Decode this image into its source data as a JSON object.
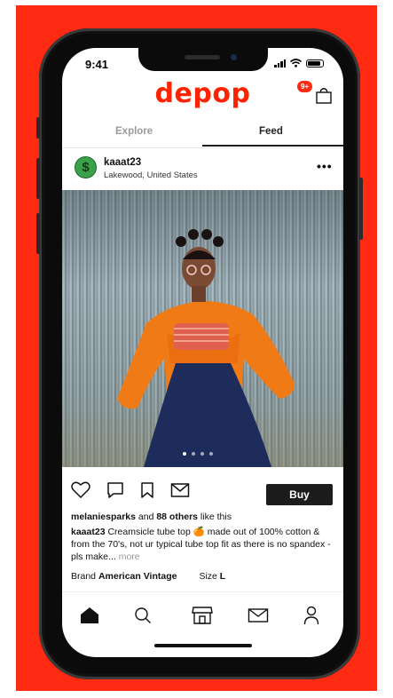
{
  "status_bar": {
    "time": "9:41"
  },
  "header": {
    "logo_text": "depop",
    "bag_badge": "9+"
  },
  "tabs": [
    {
      "label": "Explore",
      "active": false
    },
    {
      "label": "Feed",
      "active": true
    }
  ],
  "post": {
    "username": "kaaat23",
    "location": "Lakewood, United States",
    "avatar_icon": "dollar-sign-icon",
    "image_dots": {
      "count": 4,
      "active_index": 0
    },
    "actions": [
      "heart-icon",
      "comment-icon",
      "bookmark-icon",
      "message-icon"
    ],
    "buy_label": "Buy",
    "likes": {
      "user": "melaniesparks",
      "middle": " and ",
      "others": "88 others",
      "suffix": " like this"
    },
    "description": {
      "user": "kaaat23",
      "text": " Creamsicle tube top 🍊 made out of 100% cotton & from the 70's, not ur typical tube top fit as there is no spandex - pls make...",
      "more": " more"
    },
    "brand_label": "Brand ",
    "brand_value": "American Vintage",
    "size_label": "Size ",
    "size_value": "L"
  },
  "bottom_nav": [
    "home-icon",
    "search-icon",
    "shop-icon",
    "mail-icon",
    "profile-icon"
  ],
  "colors": {
    "brand": "#ff2300",
    "background": "#ff2a12",
    "button": "#1c1c1c"
  }
}
